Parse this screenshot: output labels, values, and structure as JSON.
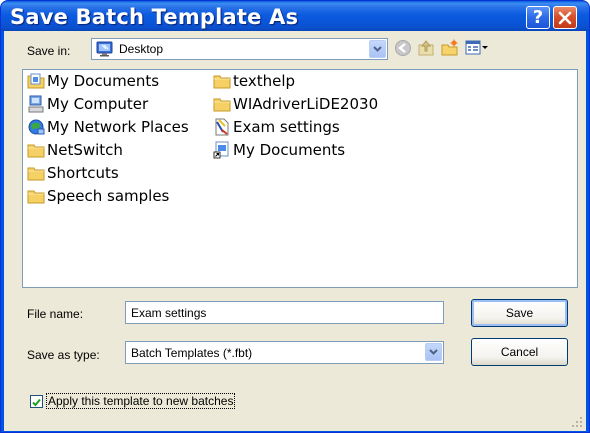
{
  "window": {
    "title": "Save Batch Template As",
    "help_symbol": "?",
    "close_symbol": "✕"
  },
  "save_in": {
    "label": "Save in:",
    "value": "Desktop"
  },
  "toolbar": {
    "icons": [
      "back-icon",
      "up-folder-icon",
      "new-folder-icon",
      "view-menu-icon"
    ]
  },
  "files": {
    "column1": [
      "My Documents",
      "My Computer",
      "My Network Places",
      "NetSwitch",
      "Shortcuts",
      "Speech samples"
    ],
    "column2": [
      "texthelp",
      "WIAdriverLiDE2030",
      "Exam settings",
      "My Documents"
    ]
  },
  "file_name": {
    "label": "File name:",
    "value": "Exam settings"
  },
  "save_as_type": {
    "label": "Save as type:",
    "value": "Batch Templates (*.fbt)"
  },
  "buttons": {
    "save": "Save",
    "cancel": "Cancel"
  },
  "apply_checkbox": {
    "label": "Apply this template to new batches",
    "checked": true
  },
  "colors": {
    "title_bar": "#0a55d9",
    "dialog_bg": "#ece9d8",
    "close_red": "#d8502c"
  }
}
